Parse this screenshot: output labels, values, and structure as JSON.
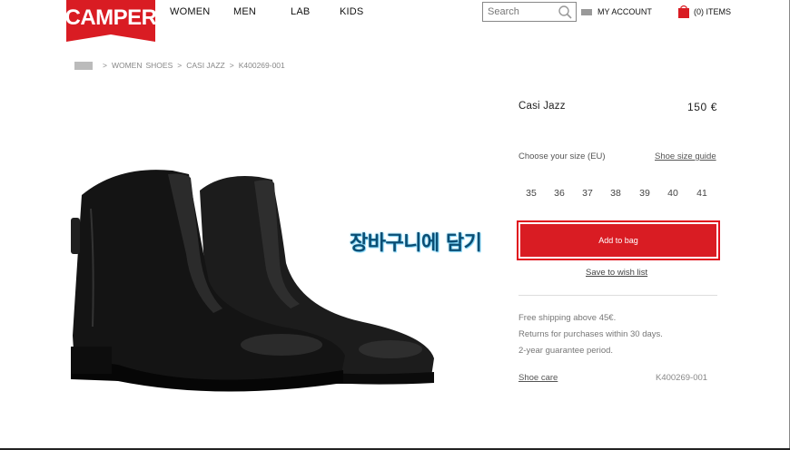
{
  "brand": {
    "logo_text": "CAMPER",
    "color": "#d91c23"
  },
  "nav": [
    "WOMEN",
    "MEN",
    "LAB",
    "KIDS"
  ],
  "search": {
    "placeholder": "Search"
  },
  "account": {
    "label": "MY ACCOUNT"
  },
  "bag": {
    "label": "(0) ITEMS"
  },
  "breadcrumb": {
    "items": [
      "WOMEN",
      "SHOES",
      "CASI JAZZ",
      "K400269-001"
    ],
    "separator": ">"
  },
  "overlay": {
    "text": "장바구니에 담기"
  },
  "product": {
    "name": "Casi Jazz",
    "price": "150  €",
    "size_label": "Choose your size (EU)",
    "size_guide": "Shoe size guide",
    "sizes": [
      "35",
      "36",
      "37",
      "38",
      "39",
      "40",
      "41"
    ],
    "add_to_bag": "Add to bag",
    "wishlist": "Save to wish list",
    "info": [
      "Free shipping above 45€.",
      "Returns for purchases within 30 days.",
      "2-year guarantee period."
    ],
    "care": "Shoe care",
    "reference": "K400269-001"
  }
}
